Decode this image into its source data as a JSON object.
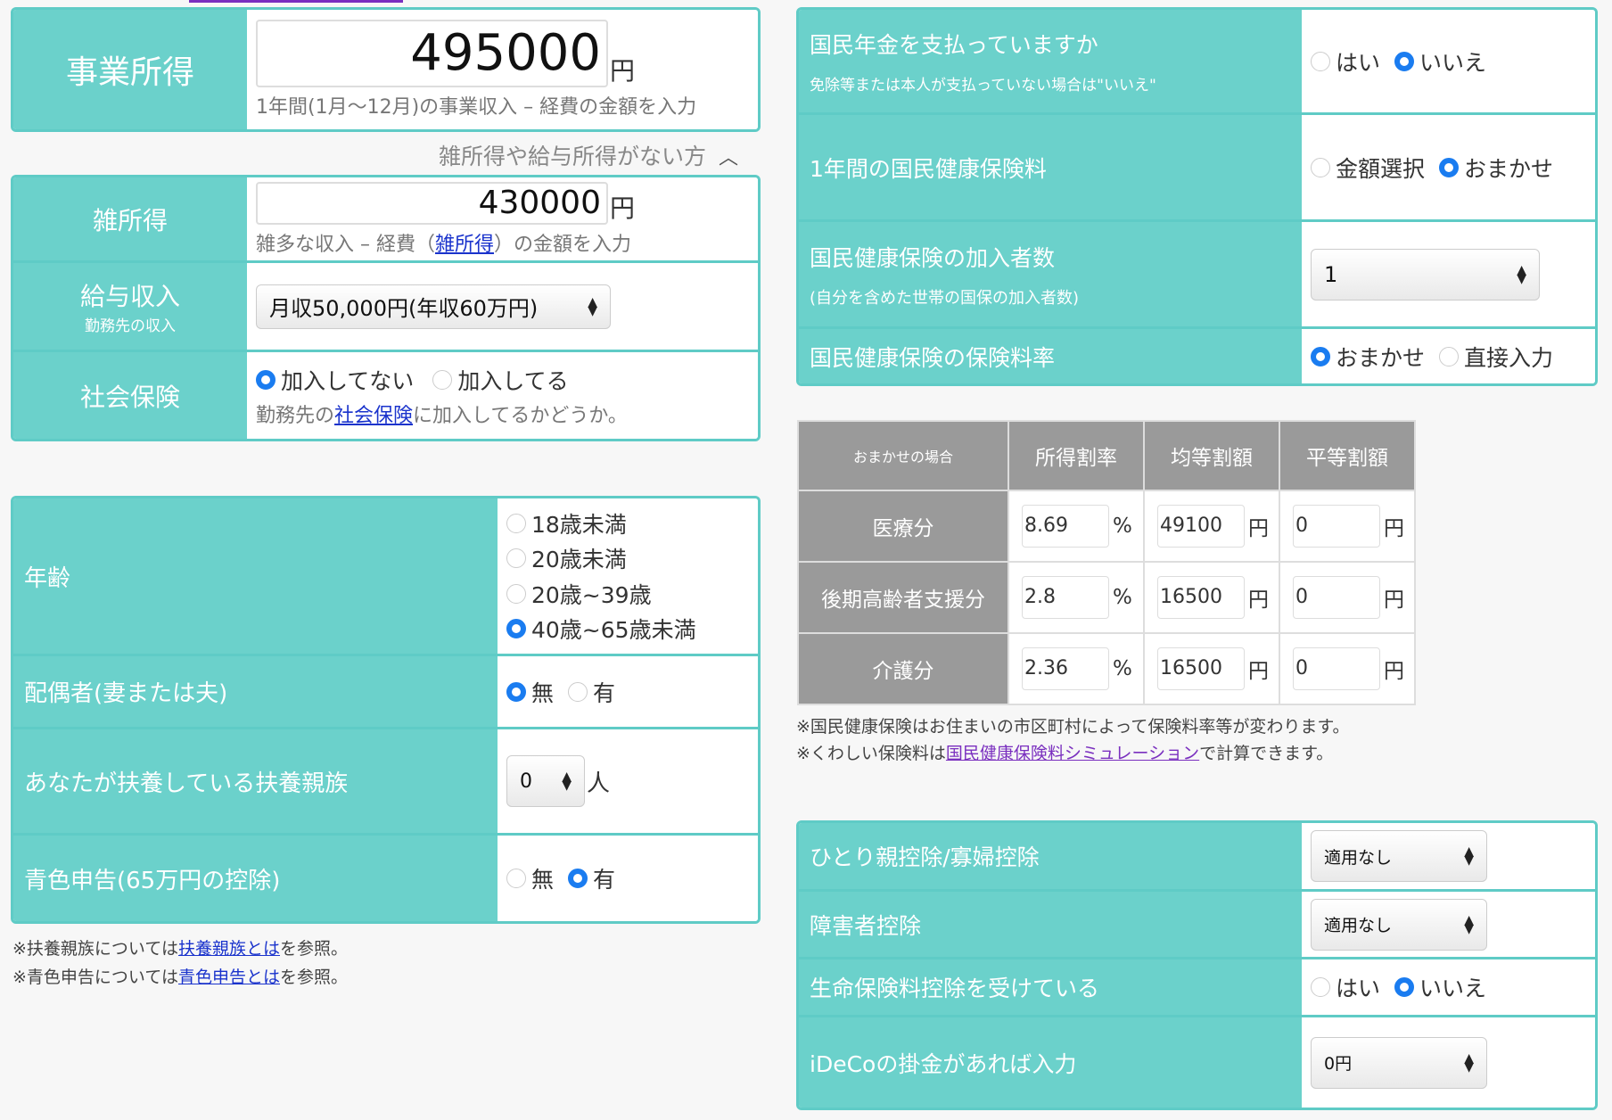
{
  "business_income": {
    "label": "事業所得",
    "value": "495000",
    "unit": "円",
    "hint": "1年間(1月〜12月)の事業収入 – 経費の金額を入力"
  },
  "toggle_text": "雑所得や給与所得がない方",
  "misc_income": {
    "label": "雑所得",
    "value": "430000",
    "unit": "円",
    "hint_pre": "雑多な収入 – 経費（",
    "hint_link": "雑所得",
    "hint_post": "）の金額を入力"
  },
  "salary": {
    "label": "給与収入",
    "sub": "勤務先の収入",
    "selected": "月収50,000円(年収60万円)"
  },
  "social_insurance": {
    "label": "社会保険",
    "opt_no": "加入してない",
    "opt_yes": "加入してる",
    "hint_pre": "勤務先の",
    "hint_link": "社会保険",
    "hint_post": "に加入してるかどうか。"
  },
  "age": {
    "label": "年齢",
    "options": [
      "18歳未満",
      "20歳未満",
      "20歳~39歳",
      "40歳~65歳未満"
    ],
    "selected_index": 3
  },
  "spouse": {
    "label": "配偶者(妻または夫)",
    "opt_no": "無",
    "opt_yes": "有"
  },
  "dependents": {
    "label": "あなたが扶養している扶養親族",
    "selected": "0",
    "unit": "人"
  },
  "blue_return": {
    "label": "青色申告(65万円の控除)",
    "opt_no": "無",
    "opt_yes": "有"
  },
  "left_notes": {
    "dep_pre": "※扶養親族については",
    "dep_link": "扶養親族とは",
    "dep_post": "を参照。",
    "blue_pre": "※青色申告については",
    "blue_link": "青色申告とは",
    "blue_post": "を参照。"
  },
  "pension": {
    "label": "国民年金を支払っていますか",
    "sub": "免除等または本人が支払っていない場合は\"いいえ\"",
    "opt_yes": "はい",
    "opt_no": "いいえ"
  },
  "nhi_premium": {
    "label": "1年間の国民健康保険料",
    "opt_a": "金額選択",
    "opt_b": "おまかせ"
  },
  "nhi_members": {
    "label": "国民健康保険の加入者数",
    "sub": "(自分を含めた世帯の国保の加入者数)",
    "selected": "1"
  },
  "nhi_rate": {
    "label": "国民健康保険の保険料率",
    "opt_a": "おまかせ",
    "opt_b": "直接入力"
  },
  "rate_table": {
    "headers": [
      "おまかせの場合",
      "所得割率",
      "均等割額",
      "平等割額"
    ],
    "rows": [
      {
        "name": "医療分",
        "rate": "8.69",
        "rate_unit": "%",
        "equal": "49100",
        "equal_unit": "円",
        "flat": "0",
        "flat_unit": "円"
      },
      {
        "name": "後期高齢者支援分",
        "rate": "2.8",
        "rate_unit": "%",
        "equal": "16500",
        "equal_unit": "円",
        "flat": "0",
        "flat_unit": "円"
      },
      {
        "name": "介護分",
        "rate": "2.36",
        "rate_unit": "%",
        "equal": "16500",
        "equal_unit": "円",
        "flat": "0",
        "flat_unit": "円"
      }
    ]
  },
  "right_notes": {
    "line1": "※国民健康保険はお住まいの市区町村によって保険料率等が変わります。",
    "line2_pre": "※くわしい保険料は",
    "line2_link": "国民健康保険料シミュレーション",
    "line2_post": "で計算できます。"
  },
  "single_parent": {
    "label": "ひとり親控除/寡婦控除",
    "selected": "適用なし"
  },
  "disability": {
    "label": "障害者控除",
    "selected": "適用なし"
  },
  "life_insurance": {
    "label": "生命保険料控除を受けている",
    "opt_yes": "はい",
    "opt_no": "いいえ"
  },
  "ideco": {
    "label": "iDeCoの掛金があれば入力",
    "selected": "0円"
  },
  "colors": {
    "teal": "#6bd1cb",
    "teal_border": "#5fcbc6",
    "header_gray": "#9a9a9a",
    "radio_on": "#1a7cf0",
    "link": "#1a33cc"
  }
}
